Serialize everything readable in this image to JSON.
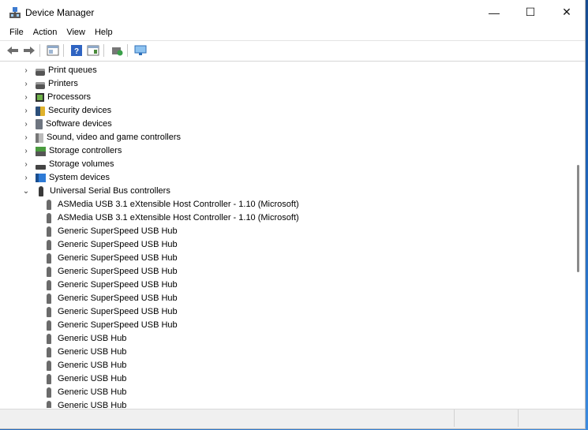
{
  "window": {
    "title": "Device Manager",
    "controls": {
      "minimize": "—",
      "maximize": "☐",
      "close": "✕"
    }
  },
  "menu": [
    "File",
    "Action",
    "View",
    "Help"
  ],
  "toolbar": {
    "buttons": [
      "back-icon",
      "forward-icon",
      "properties-icon",
      "help-icon",
      "show-hidden-icon",
      "update-driver-icon",
      "monitor-icon"
    ]
  },
  "tree": {
    "categories": [
      {
        "label": "Print queues",
        "icon": "printer-icon",
        "expanded": false
      },
      {
        "label": "Printers",
        "icon": "printer-icon",
        "expanded": false
      },
      {
        "label": "Processors",
        "icon": "cpu-icon",
        "expanded": false
      },
      {
        "label": "Security devices",
        "icon": "security-icon",
        "expanded": false
      },
      {
        "label": "Software devices",
        "icon": "software-icon",
        "expanded": false
      },
      {
        "label": "Sound, video and game controllers",
        "icon": "speaker-icon",
        "expanded": false
      },
      {
        "label": "Storage controllers",
        "icon": "storage-icon",
        "expanded": false
      },
      {
        "label": "Storage volumes",
        "icon": "volume-icon",
        "expanded": false
      },
      {
        "label": "System devices",
        "icon": "system-icon",
        "expanded": false
      },
      {
        "label": "Universal Serial Bus controllers",
        "icon": "usb-icon",
        "expanded": true
      }
    ],
    "usb_children": [
      "ASMedia USB 3.1 eXtensible Host Controller - 1.10 (Microsoft)",
      "ASMedia USB 3.1 eXtensible Host Controller - 1.10 (Microsoft)",
      "Generic SuperSpeed USB Hub",
      "Generic SuperSpeed USB Hub",
      "Generic SuperSpeed USB Hub",
      "Generic SuperSpeed USB Hub",
      "Generic SuperSpeed USB Hub",
      "Generic SuperSpeed USB Hub",
      "Generic SuperSpeed USB Hub",
      "Generic SuperSpeed USB Hub",
      "Generic USB Hub",
      "Generic USB Hub",
      "Generic USB Hub",
      "Generic USB Hub",
      "Generic USB Hub",
      "Generic USB Hub"
    ]
  },
  "chevrons": {
    "collapsed": "›",
    "expanded": "⌄"
  }
}
